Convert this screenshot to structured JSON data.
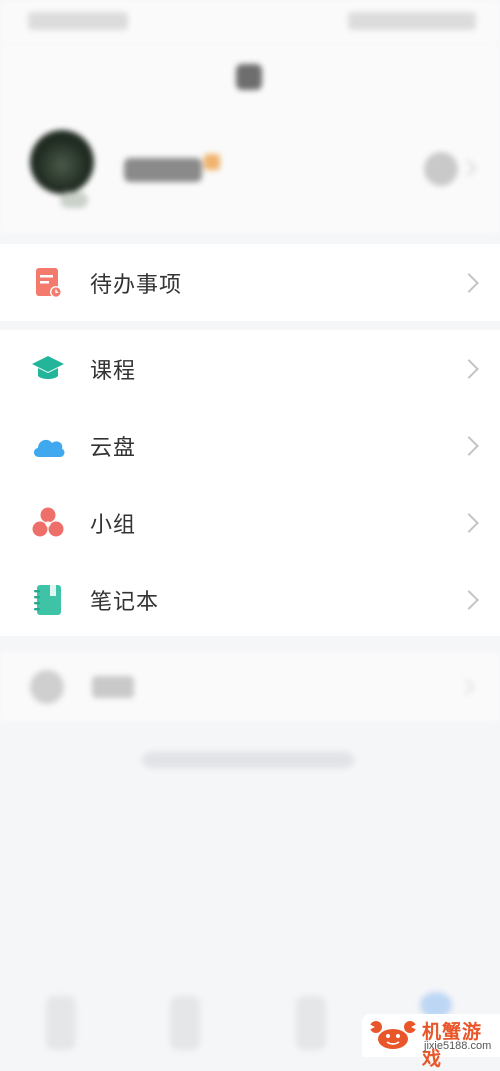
{
  "menu_todo": {
    "items": [
      {
        "label": "待办事项",
        "icon": "todo-doc-icon",
        "color": "#f47a6e"
      }
    ]
  },
  "menu_main": {
    "items": [
      {
        "label": "课程",
        "icon": "graduation-cap-icon",
        "color": "#22b59a"
      },
      {
        "label": "云盘",
        "icon": "cloud-icon",
        "color": "#3fa8ee"
      },
      {
        "label": "小组",
        "icon": "group-circles-icon",
        "color": "#ee6f6a"
      },
      {
        "label": "笔记本",
        "icon": "notebook-icon",
        "color": "#3fc3a6"
      }
    ]
  },
  "watermark": {
    "title": "机蟹游戏",
    "url": "jixie5188.com",
    "brand_color": "#e8562a"
  }
}
